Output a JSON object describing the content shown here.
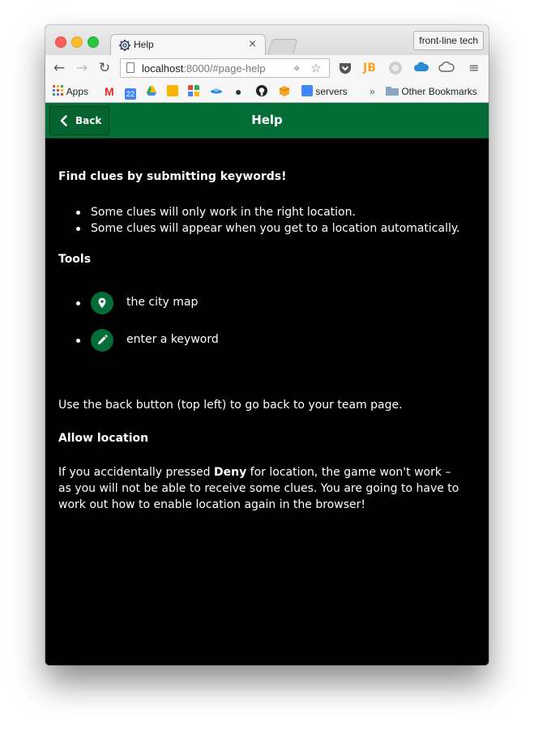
{
  "browser": {
    "tab_title": "Help",
    "tab_close": "×",
    "profile_label": "front-line tech",
    "url_host": "localhost",
    "url_rest": ":8000/#page-help",
    "bookmarks": {
      "apps": "Apps",
      "calendar_badge": "22",
      "servers": "servers",
      "overflow": "»",
      "other": "Other Bookmarks"
    },
    "extensions": {
      "jb": "JB"
    }
  },
  "appbar": {
    "back_label": "Back",
    "title": "Help"
  },
  "content": {
    "intro": "Find clues by submitting keywords!",
    "bullets": [
      "Some clues will only work in the right location.",
      "Some clues will appear when you get to a location automatically."
    ],
    "tools_heading": "Tools",
    "tools": [
      {
        "label": "the city map",
        "icon": "map-pin-icon"
      },
      {
        "label": "enter a keyword",
        "icon": "pencil-icon"
      }
    ],
    "back_instruction": "Use the back button (top left) to go back to your team page.",
    "allow_heading": "Allow location",
    "deny_pre": "If you accidentally pressed ",
    "deny_word": "Deny",
    "deny_post": " for location, the game won't work –",
    "deny_line2": "as you will not be able to receive some clues. You are going to have to",
    "deny_line3": "work out how to enable location again in the browser!"
  },
  "colors": {
    "brand_green": "#046c37",
    "page_background": "#000000",
    "text": "#ffffff"
  }
}
